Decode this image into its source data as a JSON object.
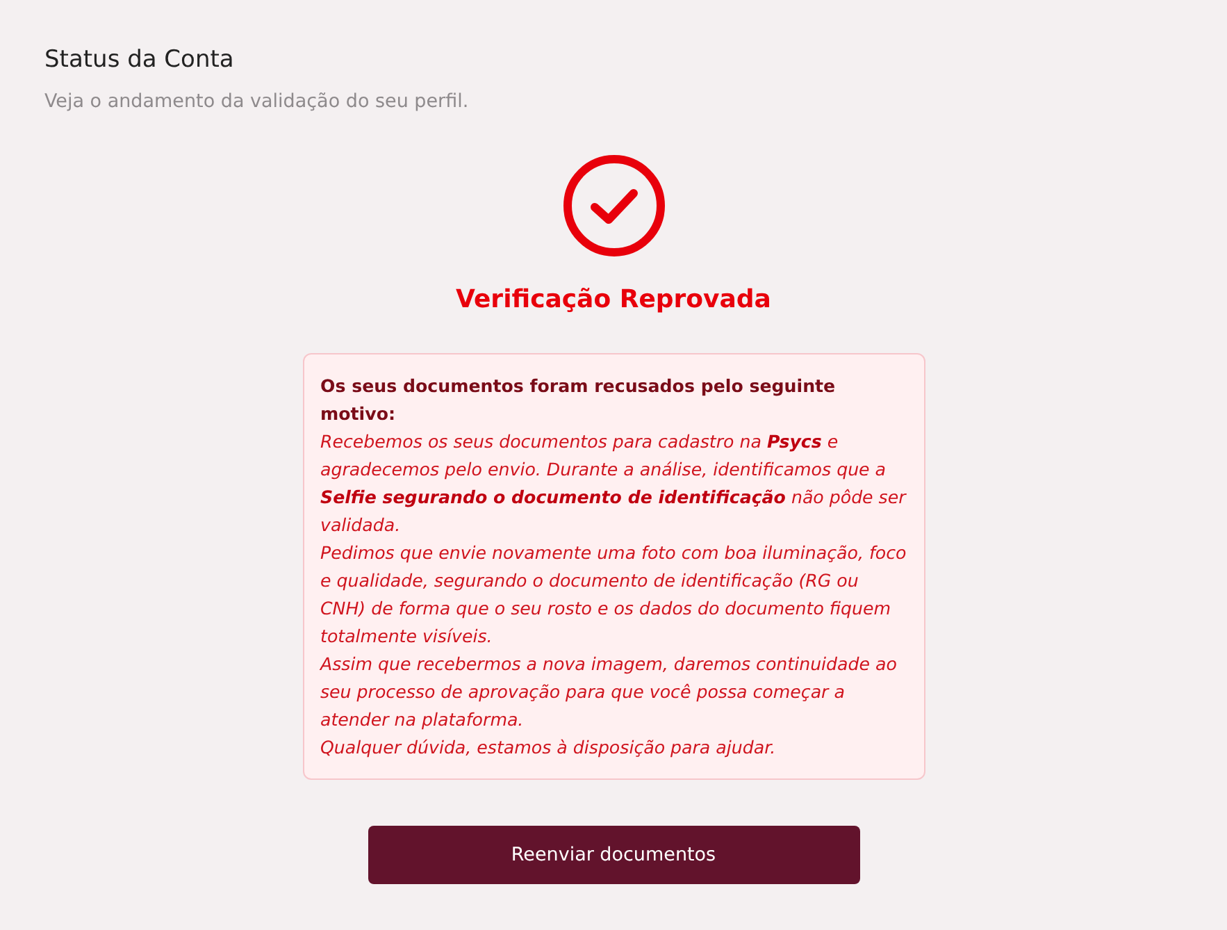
{
  "header": {
    "title": "Status da Conta",
    "subtitle": "Veja o andamento da validação do seu perfil."
  },
  "status": {
    "kind": "rejected",
    "label": "Verificação Reprovada"
  },
  "reason": {
    "heading": "Os seus documentos foram recusados pelo seguinte motivo:",
    "paragraphs": [
      "Recebemos os seus documentos para cadastro na **Psycs** e agradecemos pelo envio. Durante a análise, identificamos que a **Selfie segurando o documento de identificação** não pôde ser validada.",
      "Pedimos que envie novamente uma foto com boa iluminação, foco e qualidade, segurando o documento de identificação (RG ou CNH) de forma que o seu rosto e os dados do documento fiquem totalmente visíveis.",
      "Assim que recebermos a nova imagem, daremos continuidade ao seu processo de aprovação para que você possa começar a atender na plataforma.",
      "Qualquer dúvida, estamos à disposição para ajudar."
    ]
  },
  "button": {
    "label": "Reenviar documentos"
  }
}
